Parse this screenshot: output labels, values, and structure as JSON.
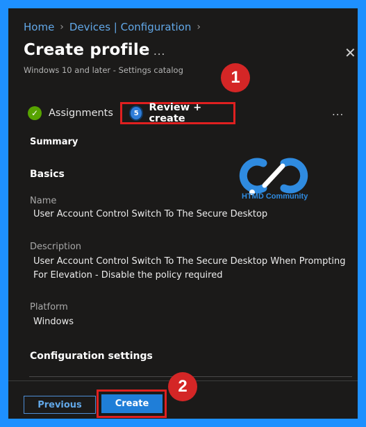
{
  "breadcrumb": {
    "home": "Home",
    "devices": "Devices | Configuration"
  },
  "header": {
    "title": "Create profile",
    "more": "...",
    "close": "✕",
    "subtitle": "Windows 10 and later - Settings catalog"
  },
  "tabs": {
    "assignments": "Assignments",
    "review_step": "5",
    "review": "Review + create",
    "more": "..."
  },
  "annotations": {
    "badge1": "1",
    "badge2": "2"
  },
  "watermark": {
    "text": "HTMD Community"
  },
  "summary": {
    "heading": "Summary",
    "basics_heading": "Basics",
    "name_label": "Name",
    "name_value": "User Account Control Switch To The Secure Desktop",
    "description_label": "Description",
    "description_value": "User Account Control Switch To The Secure Desktop When Prompting For Elevation - Disable the policy required",
    "platform_label": "Platform",
    "platform_value": "Windows",
    "config_heading": "Configuration settings"
  },
  "footer": {
    "previous": "Previous",
    "create": "Create"
  },
  "colors": {
    "frame": "#1e90ff",
    "panel": "#1b1a19",
    "link": "#62a8e8",
    "highlight": "#e02020",
    "primary_button": "#1f7ed8",
    "success": "#57a300"
  }
}
